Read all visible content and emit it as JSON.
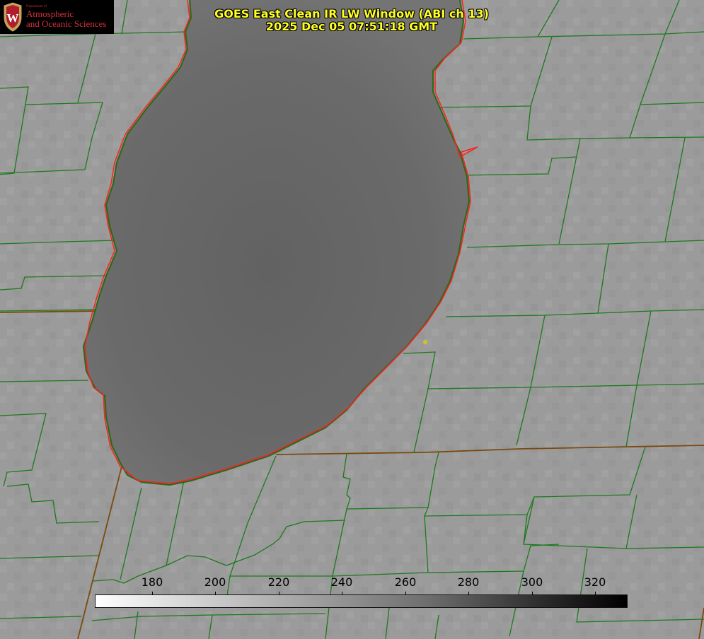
{
  "header": {
    "title_line1": "GOES East Clean IR LW Window (ABI ch 13)",
    "title_line2": "2025 Dec 05 07:51:18 GMT"
  },
  "logo": {
    "crest_letter": "W",
    "department_line": "Department of",
    "line1": "Atmospheric",
    "line2": "and Oceanic Sciences",
    "color": "#d3303a"
  },
  "colorbar": {
    "ticks": [
      "180",
      "200",
      "220",
      "240",
      "260",
      "280",
      "300",
      "320"
    ],
    "tick_values": [
      180,
      200,
      220,
      240,
      260,
      280,
      300,
      320
    ],
    "range": [
      163,
      330
    ],
    "color_start": "#ffffff",
    "color_end": "#000000"
  },
  "colors": {
    "land": "#9c9c9c",
    "lake": "#6b6b6b",
    "county_lines": "#1d7a1d",
    "coastline": "#ff2020",
    "title_text": "#ffff22",
    "marker": "#d8c020"
  }
}
